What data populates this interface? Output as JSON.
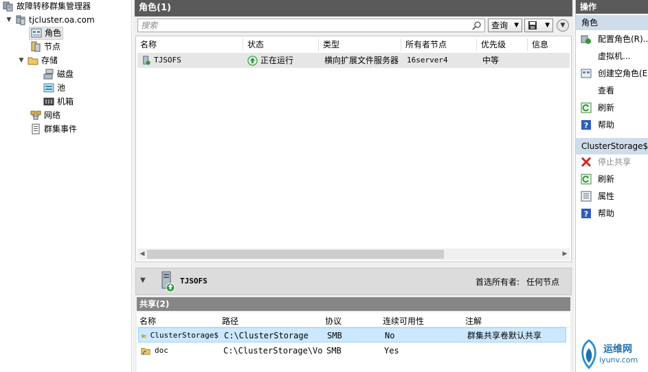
{
  "tree": {
    "root": "故障转移群集管理器",
    "cluster": "tjcluster.oa.com",
    "items": [
      {
        "label": "角色",
        "icon": "roles-icon"
      },
      {
        "label": "节点",
        "icon": "nodes-icon"
      },
      {
        "label": "存储",
        "icon": "storage-icon"
      },
      {
        "label": "磁盘",
        "icon": "disk-icon"
      },
      {
        "label": "池",
        "icon": "pool-icon"
      },
      {
        "label": "机箱",
        "icon": "enclosure-icon"
      },
      {
        "label": "网络",
        "icon": "network-icon"
      },
      {
        "label": "群集事件",
        "icon": "events-icon"
      }
    ]
  },
  "center": {
    "title": "角色(1)",
    "search_placeholder": "搜索",
    "query_label": "查询",
    "columns": [
      "名称",
      "状态",
      "类型",
      "所有者节点",
      "优先级",
      "信息"
    ],
    "rows": [
      {
        "name": "TJSOFS",
        "status": "正在运行",
        "type": "横向扩展文件服务器",
        "owner": "16server4",
        "priority": "中等",
        "info": ""
      }
    ],
    "detail": {
      "name": "TJSOFS",
      "preferred_owner_label": "首选所有者:",
      "preferred_owner_value": "任何节点"
    },
    "shares": {
      "title": "共享(2)",
      "columns": [
        "名称",
        "路径",
        "协议",
        "连续可用性",
        "注解"
      ],
      "rows": [
        {
          "name": "ClusterStorage$",
          "path": "C:\\ClusterStorage",
          "protocol": "SMB",
          "ca": "No",
          "remark": "群集共享卷默认共享"
        },
        {
          "name": "doc",
          "path": "C:\\ClusterStorage\\Vo...",
          "protocol": "SMB",
          "ca": "Yes",
          "remark": ""
        }
      ]
    }
  },
  "actions": {
    "title": "操作",
    "section1": {
      "title": "角色",
      "items": [
        {
          "label": "配置角色(R)...",
          "icon": "configure-role-icon"
        },
        {
          "label": "虚拟机...",
          "icon": ""
        },
        {
          "label": "创建空角色(E)",
          "icon": "create-empty-role-icon"
        },
        {
          "label": "查看",
          "icon": ""
        },
        {
          "label": "刷新",
          "icon": "refresh-icon"
        },
        {
          "label": "帮助",
          "icon": "help-icon"
        }
      ]
    },
    "section2": {
      "title": "ClusterStorage$",
      "items": [
        {
          "label": "停止共享",
          "icon": "stop-icon",
          "disabled": true
        },
        {
          "label": "刷新",
          "icon": "refresh-icon"
        },
        {
          "label": "属性",
          "icon": "properties-icon"
        },
        {
          "label": "帮助",
          "icon": "help-icon"
        }
      ]
    }
  },
  "watermark": {
    "line1": "运维网",
    "line2": "iyunv.com"
  },
  "colors": {
    "header_dark": "#5a5a5a",
    "section_blue": "#cfdce9",
    "selection_blue": "#cce8ff",
    "running_green": "#2f9a34"
  }
}
